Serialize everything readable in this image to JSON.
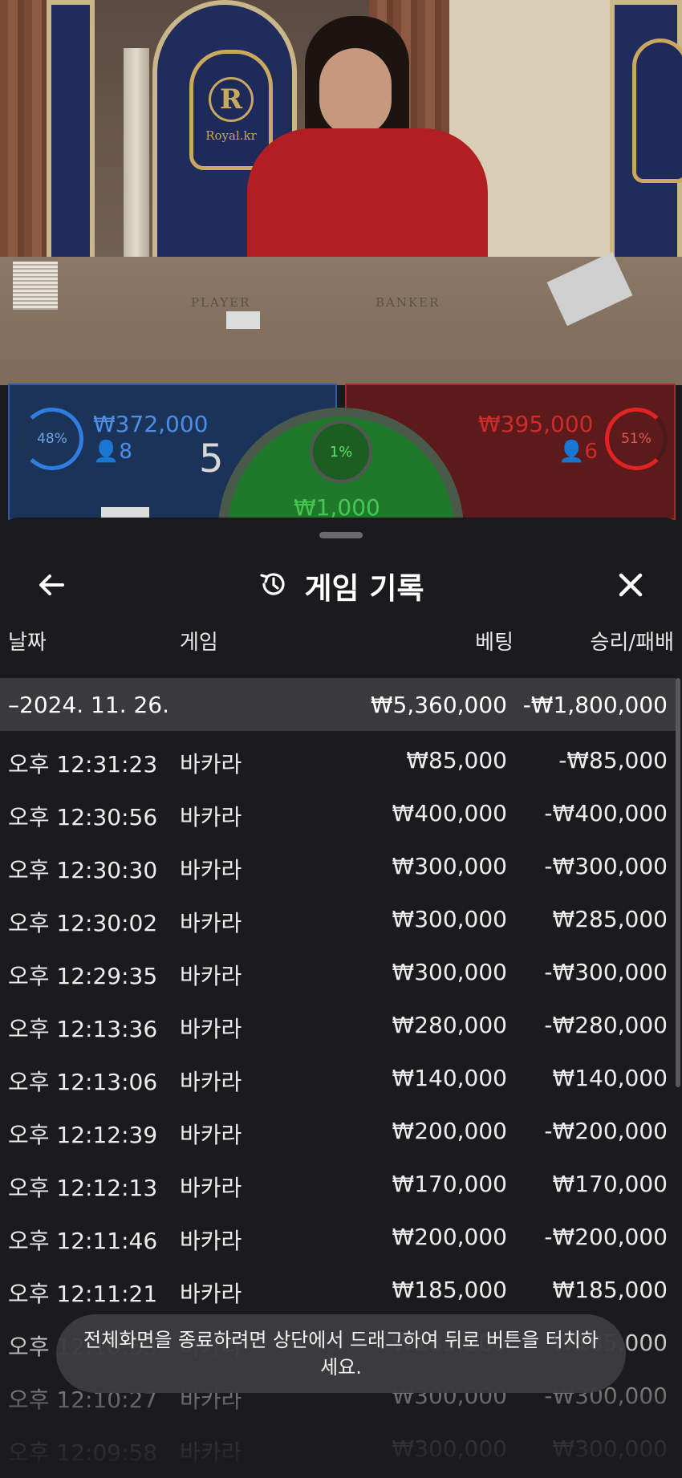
{
  "video": {
    "brand": "Royal.kr",
    "crest_letter": "R",
    "felt_player": "PLAYER",
    "felt_banker": "BANKER"
  },
  "bets": {
    "player": {
      "percent": "48%",
      "amount": "₩372,000",
      "count": "8",
      "score": "5",
      "color": "#2f7de0"
    },
    "banker": {
      "percent": "51%",
      "amount": "₩395,000",
      "count": "6",
      "color": "#e02424"
    },
    "tie": {
      "percent": "1%",
      "amount": "₩1,000",
      "color": "#46c850"
    }
  },
  "sheet": {
    "title": "게임 기록",
    "back_icon": "arrow-left-icon",
    "history_icon": "history-icon",
    "close_icon": "close-icon",
    "columns": {
      "date": "날짜",
      "game": "게임",
      "bet": "베팅",
      "win_loss": "승리/패배"
    },
    "day": {
      "date": "–2024. 11. 26.",
      "bet": "₩5,360,000",
      "win_loss": "-₩1,800,000"
    },
    "rows": [
      {
        "time": "오후 12:31:23",
        "game": "바카라",
        "bet": "₩85,000",
        "win_loss": "-₩85,000"
      },
      {
        "time": "오후 12:30:56",
        "game": "바카라",
        "bet": "₩400,000",
        "win_loss": "-₩400,000"
      },
      {
        "time": "오후 12:30:30",
        "game": "바카라",
        "bet": "₩300,000",
        "win_loss": "-₩300,000"
      },
      {
        "time": "오후 12:30:02",
        "game": "바카라",
        "bet": "₩300,000",
        "win_loss": "₩285,000"
      },
      {
        "time": "오후 12:29:35",
        "game": "바카라",
        "bet": "₩300,000",
        "win_loss": "-₩300,000"
      },
      {
        "time": "오후 12:13:36",
        "game": "바카라",
        "bet": "₩280,000",
        "win_loss": "-₩280,000"
      },
      {
        "time": "오후 12:13:06",
        "game": "바카라",
        "bet": "₩140,000",
        "win_loss": "₩140,000"
      },
      {
        "time": "오후 12:12:39",
        "game": "바카라",
        "bet": "₩200,000",
        "win_loss": "-₩200,000"
      },
      {
        "time": "오후 12:12:13",
        "game": "바카라",
        "bet": "₩170,000",
        "win_loss": "₩170,000"
      },
      {
        "time": "오후 12:11:46",
        "game": "바카라",
        "bet": "₩200,000",
        "win_loss": "-₩200,000"
      },
      {
        "time": "오후 12:11:21",
        "game": "바카라",
        "bet": "₩185,000",
        "win_loss": "₩185,000"
      },
      {
        "time": "오후 12:10:53",
        "game": "바카라",
        "bet": "₩185,000",
        "win_loss": "₩185,000"
      },
      {
        "time": "오후 12:10:27",
        "game": "바카라",
        "bet": "₩300,000",
        "win_loss": "-₩300,000"
      },
      {
        "time": "오후 12:09:58",
        "game": "바카라",
        "bet": "₩300,000",
        "win_loss": "₩300,000"
      }
    ]
  },
  "toast": {
    "text": "전체화면을 종료하려면 상단에서 드래그하여 뒤로 버튼을 터치하세요."
  }
}
